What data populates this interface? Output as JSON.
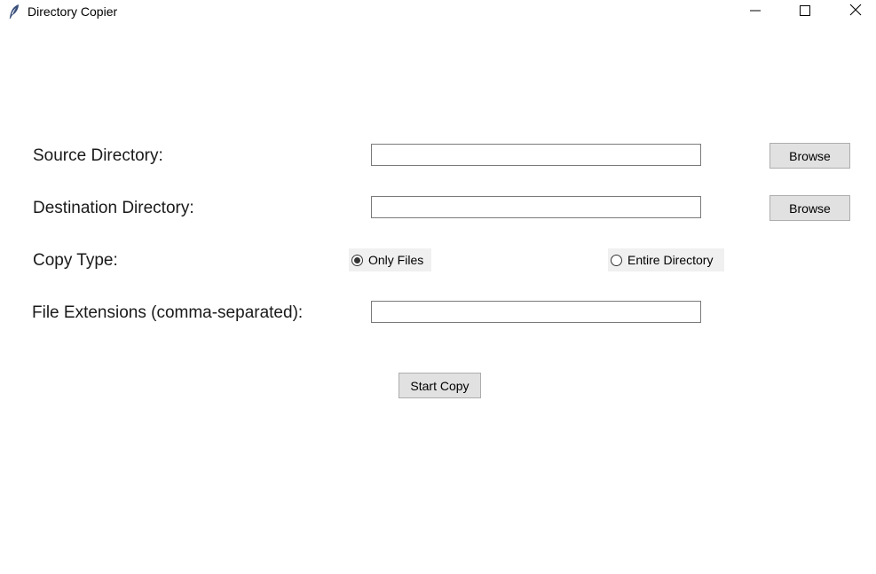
{
  "window": {
    "title": "Directory Copier",
    "icon": "feather-icon",
    "controls": [
      "minimize-icon",
      "maximize-icon",
      "close-icon"
    ]
  },
  "form": {
    "source": {
      "label": "Source Directory:",
      "value": "",
      "browse_label": "Browse"
    },
    "destination": {
      "label": "Destination Directory:",
      "value": "",
      "browse_label": "Browse"
    },
    "copy_type": {
      "label": "Copy Type:",
      "options": [
        {
          "label": "Only Files",
          "selected": true
        },
        {
          "label": "Entire Directory",
          "selected": false
        }
      ]
    },
    "extensions": {
      "label": "File Extensions (comma-separated):",
      "value": ""
    },
    "start_label": "Start Copy"
  },
  "colors": {
    "button_bg": "#e1e1e1",
    "button_border": "#adadad",
    "radio_bg": "#f0f0f0",
    "entry_border": "#7a7a7a"
  }
}
